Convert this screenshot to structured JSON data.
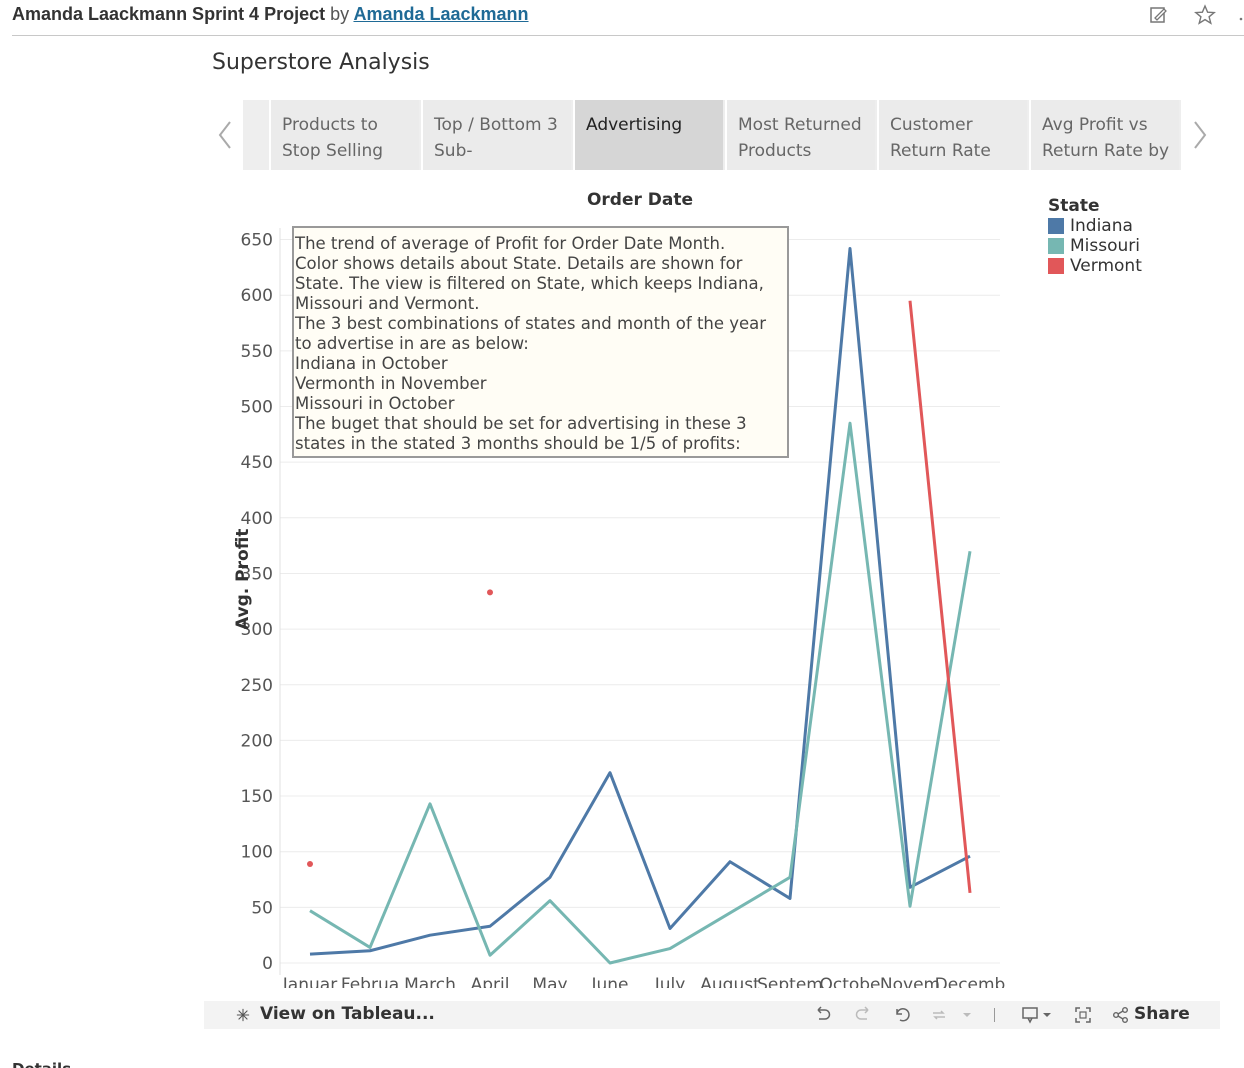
{
  "header": {
    "title": "Amanda Laackmann Sprint 4 Project",
    "by": "by",
    "author": "Amanda Laackmann"
  },
  "dashboard": {
    "title": "Superstore Analysis"
  },
  "tabs": [
    {
      "label": "Products to Stop Selling"
    },
    {
      "label": "Top / Bottom 3 Sub-"
    },
    {
      "label": "Advertising"
    },
    {
      "label": "Most Returned Products"
    },
    {
      "label": "Customer Return Rate"
    },
    {
      "label": "Avg Profit vs Return Rate by"
    }
  ],
  "active_tab": 2,
  "tooltip": {
    "lines": [
      "The trend of average of Profit for Order Date Month.",
      "Color shows details about State.  Details are shown for",
      "State. The view is filtered on State, which keeps Indiana,",
      "Missouri and Vermont.",
      "The 3 best combinations of states and month of the year",
      "to advertise in are as below:",
      "Indiana in October",
      "Vermonth in November",
      "Missouri in October",
      "The buget that should be set for advertising in these 3",
      "states in the stated 3 months should be 1/5 of profits:"
    ]
  },
  "chart_data": {
    "type": "line",
    "title": "",
    "xlabel": "Order Date",
    "ylabel": "Avg. Profit",
    "categories": [
      "January",
      "February",
      "March",
      "April",
      "May",
      "June",
      "July",
      "August",
      "September",
      "October",
      "November",
      "December"
    ],
    "category_labels_shown": [
      "Januar",
      "Februa",
      "March",
      "April",
      "May",
      "June",
      "July",
      "August",
      "Septem",
      "Octobe",
      "Novem",
      "Decemb"
    ],
    "ylim": [
      0,
      675
    ],
    "yticks": [
      0,
      50,
      100,
      150,
      200,
      250,
      300,
      350,
      400,
      450,
      500,
      550,
      600,
      650
    ],
    "grid": true,
    "legend_title": "State",
    "legend_position": "right",
    "series": [
      {
        "name": "Indiana",
        "color": "#4e79a7",
        "values": [
          8,
          11,
          25,
          33,
          77,
          171,
          31,
          91,
          58,
          642,
          68,
          96
        ]
      },
      {
        "name": "Missouri",
        "color": "#76b7b2",
        "values": [
          47,
          14,
          143,
          7,
          56,
          0,
          13,
          45,
          77,
          485,
          51,
          370
        ]
      },
      {
        "name": "Vermont",
        "color": "#e15759",
        "values": [
          89,
          null,
          null,
          333,
          null,
          null,
          null,
          null,
          null,
          null,
          595,
          63
        ]
      }
    ]
  },
  "toolbar": {
    "view_on": "View on Tableau...",
    "share": "Share"
  },
  "footer": {
    "details": "Details"
  }
}
